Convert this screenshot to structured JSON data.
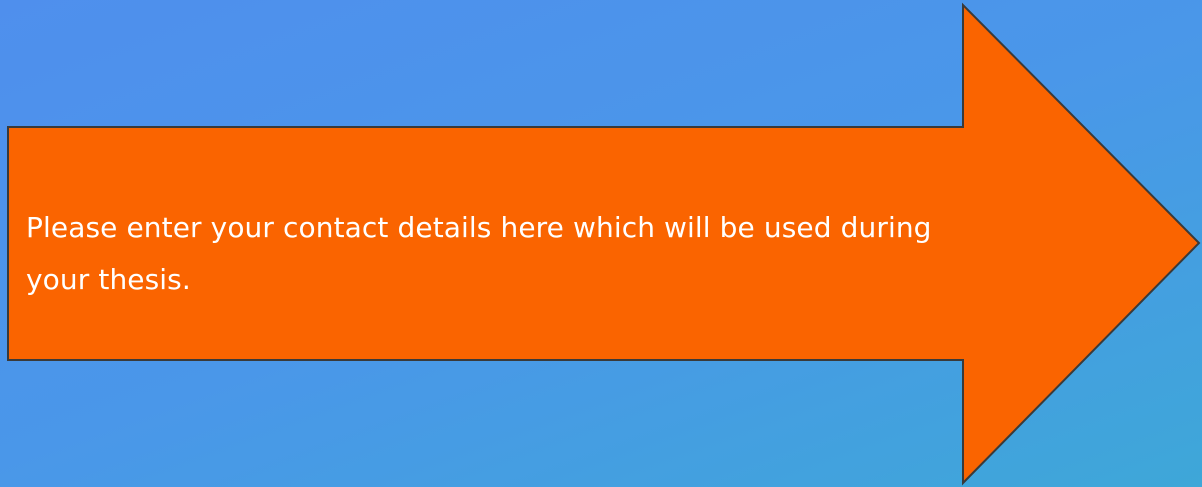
{
  "callout": {
    "text": "Please enter your contact details here which will be used during your thesis.",
    "fill_color": "#fa6400",
    "stroke_color": "#3a3a3a"
  },
  "background": {
    "gradient_start": "#4f8fed",
    "gradient_end": "#3ea7d8"
  }
}
